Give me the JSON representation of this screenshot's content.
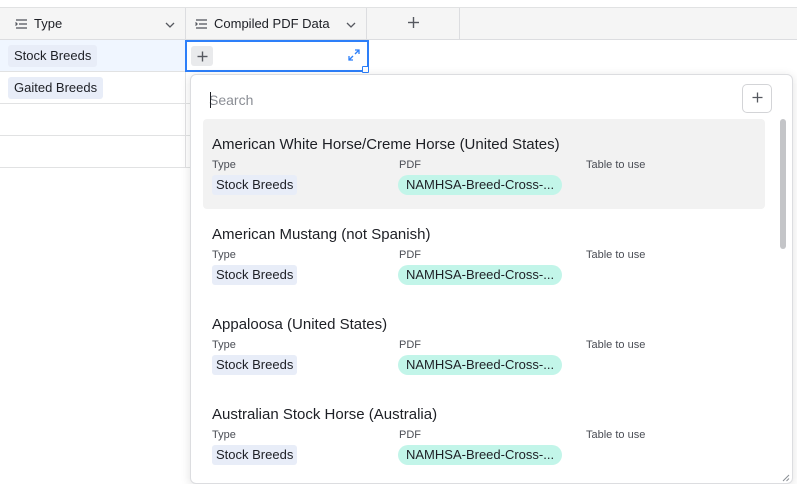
{
  "columns": [
    {
      "label": "Type",
      "icon": "multiple-select-field-icon"
    },
    {
      "label": "Compiled PDF Data",
      "icon": "lookup-field-icon"
    }
  ],
  "add_column_icon": "plus-icon",
  "rows": [
    {
      "type": "Stock Breeds"
    },
    {
      "type": "Gaited Breeds"
    },
    {
      "type": ""
    },
    {
      "type": ""
    }
  ],
  "popup": {
    "search_placeholder": "Search",
    "search_value": "",
    "labels": {
      "type": "Type",
      "pdf": "PDF",
      "table": "Table to use"
    },
    "records": [
      {
        "title": "American White Horse/Creme Horse (United States)",
        "type": "Stock Breeds",
        "pdf": "NAMHSA-Breed-Cross-...",
        "table": ""
      },
      {
        "title": "American Mustang (not Spanish)",
        "type": "Stock Breeds",
        "pdf": "NAMHSA-Breed-Cross-...",
        "table": ""
      },
      {
        "title": "Appaloosa (United States)",
        "type": "Stock Breeds",
        "pdf": "NAMHSA-Breed-Cross-...",
        "table": ""
      },
      {
        "title": "Australian Stock Horse (Australia)",
        "type": "Stock Breeds",
        "pdf": "NAMHSA-Breed-Cross-...",
        "table": ""
      }
    ]
  },
  "colors": {
    "accent": "#2d7ff9",
    "pdf_chip": "#c2f5e9",
    "type_chip": "#e8edf8",
    "highlight": "#f2f2f2"
  }
}
